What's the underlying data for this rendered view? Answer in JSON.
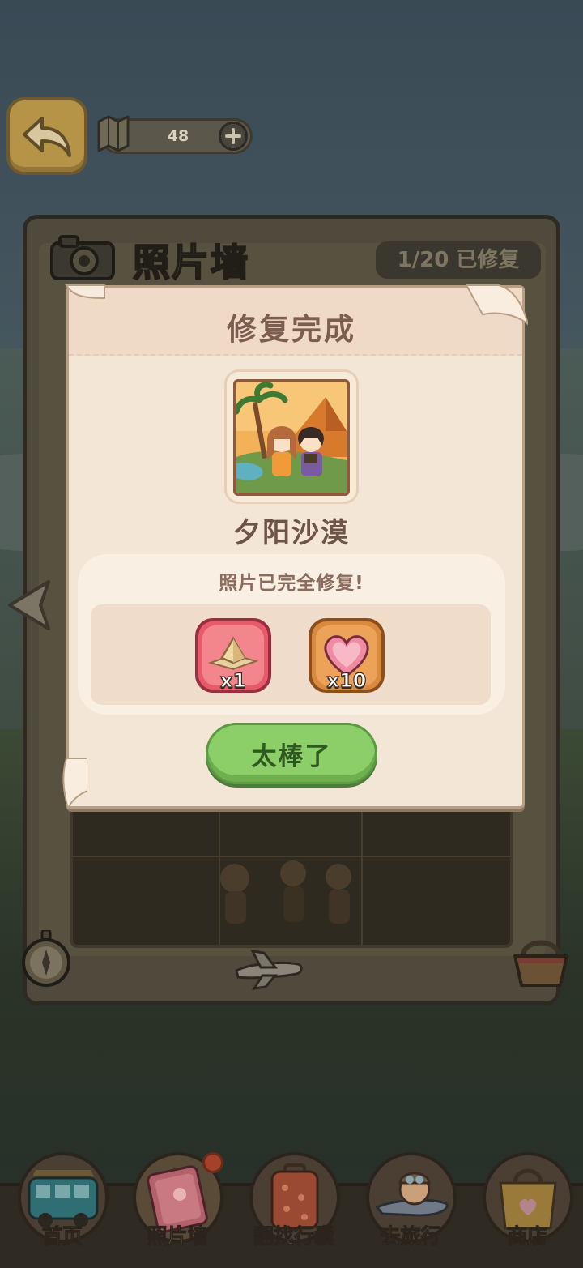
{
  "top_bar": {
    "map_count": "48"
  },
  "board": {
    "title": "照片墙",
    "progress": "1/20 已修复"
  },
  "modal": {
    "title": "修复完成",
    "photo_name": "夕阳沙漠",
    "subtitle": "照片已完全修复!",
    "rewards": [
      {
        "icon": "pyramid-icon",
        "count": "x1"
      },
      {
        "icon": "heart-icon",
        "count": "x10"
      }
    ],
    "confirm_label": "太棒了"
  },
  "bottom_nav": [
    {
      "label": "首页",
      "icon": "bus-icon"
    },
    {
      "label": "照片墙",
      "icon": "album-icon"
    },
    {
      "label": "翻找行囊",
      "icon": "suitcase-icon"
    },
    {
      "label": "去旅行",
      "icon": "traveler-icon"
    },
    {
      "label": "商店",
      "icon": "shopping-bag-icon"
    }
  ],
  "colors": {
    "confirm_button": "#8ccf68",
    "modal_paper": "#f3e6d6",
    "title_text": "#7c5d4f"
  }
}
